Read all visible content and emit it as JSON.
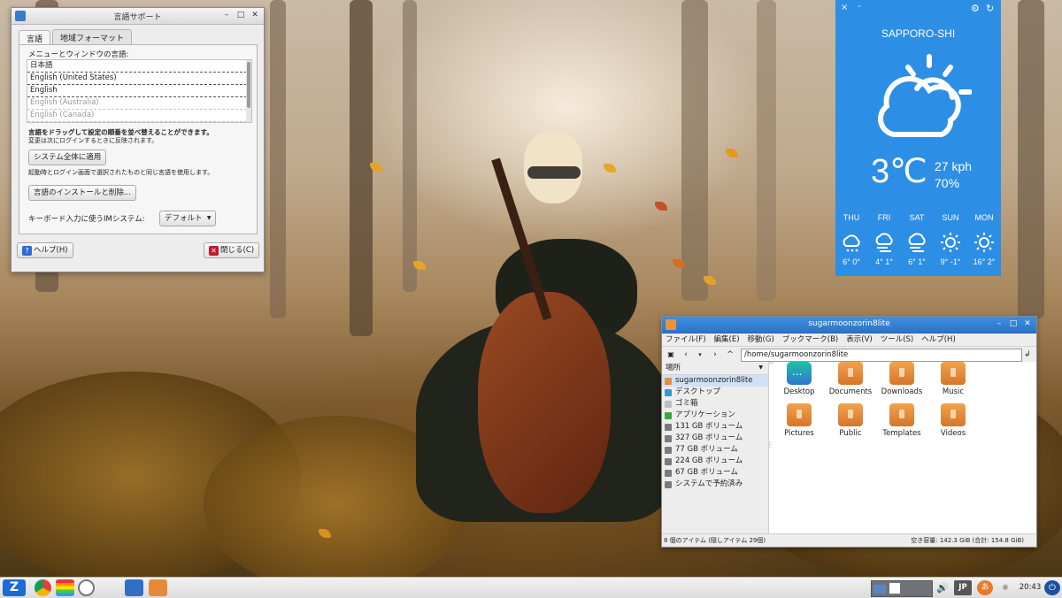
{
  "colors": {
    "weather_bg": "#2d8ee6",
    "fm_title": "#2b74c8",
    "zorin_blue": "#1c6ad6",
    "folder_orange": "#e68a3a"
  },
  "language_window": {
    "title": "言語サポート",
    "tabs": [
      "言語",
      "地域フォーマット"
    ],
    "menu_language_label": "メニューとウィンドウの言語:",
    "languages": [
      "日本語",
      "English (United States)",
      "English",
      "English (Australia)",
      "English (Canada)"
    ],
    "drag_hint": "言語をドラッグして設定の順番を並べ替えることができます。",
    "login_hint": "変更は次にログインするときに反映されます。",
    "apply_system": "システム全体に適用",
    "apply_hint": "起動時とログイン画面で選択されたものと同じ言語を使用します。",
    "install_remove": "言語のインストールと削除...",
    "im_label": "キーボード入力に使うIMシステム:",
    "im_value": "デフォルト",
    "help": "ヘルプ(H)",
    "close": "閉じる(C)"
  },
  "weather": {
    "city": "SAPPORO-SHI",
    "temp": "3℃",
    "wind": "27 kph",
    "humidity": "70%",
    "close_icon": "close-icon",
    "minimize": "-",
    "forecast": [
      {
        "day": "THU",
        "icon": "snow-cloud-icon",
        "range": "6° 0°"
      },
      {
        "day": "FRI",
        "icon": "wind-cloud-icon",
        "range": "4° 1°"
      },
      {
        "day": "SAT",
        "icon": "wind-cloud-icon",
        "range": "6° 1°"
      },
      {
        "day": "SUN",
        "icon": "sun-icon",
        "range": "9° -1°"
      },
      {
        "day": "MON",
        "icon": "sun-icon",
        "range": "16° 2°"
      }
    ]
  },
  "file_manager": {
    "title": "sugarmoonzorin8lite",
    "menu": [
      "ファイル(F)",
      "編集(E)",
      "移動(G)",
      "ブックマーク(B)",
      "表示(V)",
      "ツール(S)",
      "ヘルプ(H)"
    ],
    "path": "/home/sugarmoonzorin8lite",
    "places_label": "場所",
    "places": [
      "sugarmoonzorin8lite",
      "デスクトップ",
      "ゴミ箱",
      "アプリケーション",
      "131 GB ボリューム",
      "327 GB ボリューム",
      "77 GB ボリューム",
      "224 GB ボリューム",
      "67 GB ボリューム",
      "システムで予約済み"
    ],
    "files": [
      "Desktop",
      "Documents",
      "Downloads",
      "Music",
      "Pictures",
      "Public",
      "Templates",
      "Videos"
    ],
    "status_left": "8 個のアイテム (隠しアイテム 29個)",
    "status_right": "空き容量: 142.3 GiB (合計: 154.8 GiB)"
  },
  "taskbar": {
    "lang": "JP",
    "ime": "あ",
    "clock": "20:43"
  }
}
